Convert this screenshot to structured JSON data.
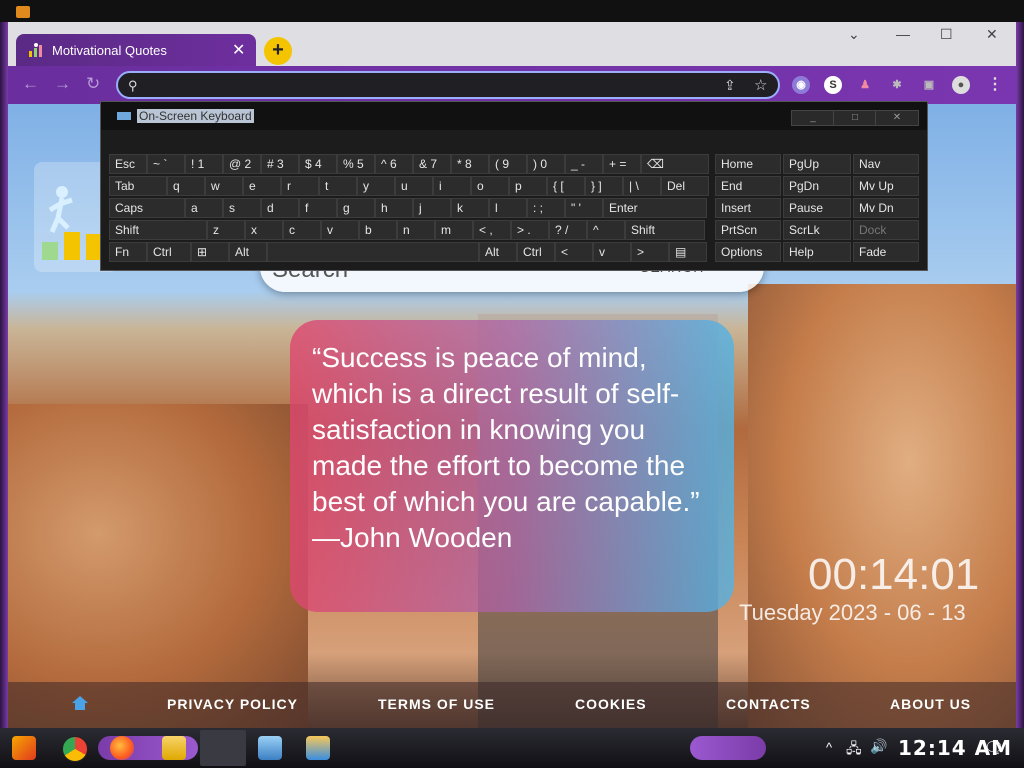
{
  "browser": {
    "tab_title": "Motivational Quotes",
    "tab_close": "✕",
    "new_tab": "+",
    "window_controls": {
      "dropdown": "⌄",
      "minimize": "—",
      "maximize": "☐",
      "close": "✕"
    },
    "nav": {
      "back": "←",
      "forward": "→",
      "reload": "↻"
    },
    "omnibox_value": "",
    "omnibox_share_icon": "⇪",
    "omnibox_star_icon": "☆",
    "extensions": [
      "◉",
      "S",
      "♟",
      "✱",
      "▣"
    ],
    "profile_icon": "●",
    "menu": "⋮"
  },
  "osk": {
    "title": "On-Screen Keyboard",
    "window_buttons": [
      "_",
      "□",
      "✕"
    ],
    "rows": [
      [
        [
          "Esc",
          38
        ],
        [
          "~ `",
          38
        ],
        [
          "! 1",
          38
        ],
        [
          "@ 2",
          38
        ],
        [
          "# 3",
          38
        ],
        [
          "$ 4",
          38
        ],
        [
          "% 5",
          38
        ],
        [
          "^ 6",
          38
        ],
        [
          "& 7",
          38
        ],
        [
          "* 8",
          38
        ],
        [
          "( 9",
          38
        ],
        [
          ") 0",
          38
        ],
        [
          "_ -",
          38
        ],
        [
          "+ =",
          38
        ],
        [
          "⌫",
          68
        ]
      ],
      [
        [
          "Tab",
          58
        ],
        [
          "q",
          38
        ],
        [
          "w",
          38
        ],
        [
          "e",
          38
        ],
        [
          "r",
          38
        ],
        [
          "t",
          38
        ],
        [
          "y",
          38
        ],
        [
          "u",
          38
        ],
        [
          "i",
          38
        ],
        [
          "o",
          38
        ],
        [
          "p",
          38
        ],
        [
          "{ [",
          38
        ],
        [
          "} ]",
          38
        ],
        [
          "| \\",
          38
        ],
        [
          "Del",
          48
        ]
      ],
      [
        [
          "Caps",
          76
        ],
        [
          "a",
          38
        ],
        [
          "s",
          38
        ],
        [
          "d",
          38
        ],
        [
          "f",
          38
        ],
        [
          "g",
          38
        ],
        [
          "h",
          38
        ],
        [
          "j",
          38
        ],
        [
          "k",
          38
        ],
        [
          "l",
          38
        ],
        [
          ": ;",
          38
        ],
        [
          "\" '",
          38
        ],
        [
          "Enter",
          104
        ]
      ],
      [
        [
          "Shift",
          98
        ],
        [
          "z",
          38
        ],
        [
          "x",
          38
        ],
        [
          "c",
          38
        ],
        [
          "v",
          38
        ],
        [
          "b",
          38
        ],
        [
          "n",
          38
        ],
        [
          "m",
          38
        ],
        [
          "< ,",
          38
        ],
        [
          "> .",
          38
        ],
        [
          "? /",
          38
        ],
        [
          "^",
          38
        ],
        [
          "Shift",
          80
        ]
      ],
      [
        [
          "Fn",
          38
        ],
        [
          "Ctrl",
          44
        ],
        [
          "⊞",
          38
        ],
        [
          "Alt",
          38
        ],
        [
          "",
          212
        ],
        [
          "Alt",
          38
        ],
        [
          "Ctrl",
          38
        ],
        [
          "<",
          38
        ],
        [
          "v",
          38
        ],
        [
          ">",
          38
        ],
        [
          "▤",
          38
        ]
      ]
    ],
    "nav_keys": [
      [
        "Home",
        "PgUp",
        "Nav"
      ],
      [
        "End",
        "PgDn",
        "Mv Up"
      ],
      [
        "Insert",
        "Pause",
        "Mv Dn"
      ],
      [
        "PrtScn",
        "ScrLk",
        "Dock"
      ],
      [
        "Options",
        "Help",
        "Fade"
      ]
    ]
  },
  "page": {
    "search_placeholder": "Search",
    "search_button": "SEARCH",
    "quote": "“Success is peace of mind, which is a direct result of self-satisfaction in knowing you made the effort to become the best of which you are capable.” —John Wooden",
    "clock": "00:14:01",
    "date": "Tuesday 2023 - 06 - 13",
    "footer_links": [
      "PRIVACY POLICY",
      "TERMS OF USE",
      "COOKIES",
      "CONTACTS",
      "ABOUT US"
    ]
  },
  "taskbar": {
    "time": "12:14 AM",
    "tray_icons": [
      "^",
      "🖧",
      "🔊",
      "🗨"
    ]
  }
}
